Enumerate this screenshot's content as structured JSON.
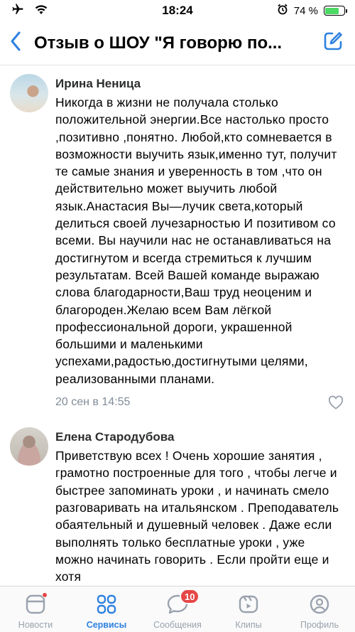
{
  "status_bar": {
    "time": "18:24",
    "battery_percent": "74 %",
    "battery_level": 0.74,
    "icons": [
      "airplane-icon",
      "wifi-icon",
      "alarm-icon",
      "battery-icon"
    ]
  },
  "header": {
    "title": "Отзыв о ШОУ \"Я говорю по...",
    "icons": [
      "back-chevron-icon",
      "edit-icon"
    ]
  },
  "comments": [
    {
      "author": "Ирина Неница",
      "text": "Никогда в жизни не получала столько положительной энергии.Все настолько просто ,позитивно ,понятно. Любой,кто сомневается в возможности выучить язык,именно тут, получит те самые знания и уверенность в том ,что он действительно может выучить любой язык.Анастасия Вы—лучик света,который делиться своей лучезарностью И позитивом со всеми. Вы научили нас не останавливаться на достигнутом и всегда стремиться к лучшим результатам. Всей  Вашей команде выражаю слова благодарности,Ваш труд неоценим и благороден.Желаю всем Вам лёгкой профессиональной дороги, украшенной большими и маленькими успехами,радостью,достигнутыми целями, реализованными планами.",
      "date": "20 сен в 14:55"
    },
    {
      "author": "Елена Стародубова",
      "text": "Приветствую всех ! Очень хорошие занятия , грамотно построенные для того , чтобы легче и быстрее запоминать уроки , и начинать смело разговаривать на итальянском . Преподаватель обаятельный и душевный человек . Даже если выполнять только бесплатные уроки , уже можно начинать говорить . Если пройти еще и хотя"
    }
  ],
  "tabbar": {
    "tabs": [
      {
        "label": "Новости",
        "icon": "news-icon"
      },
      {
        "label": "Сервисы",
        "icon": "services-icon"
      },
      {
        "label": "Сообщения",
        "icon": "messages-icon",
        "badge": "10"
      },
      {
        "label": "Клипы",
        "icon": "clips-icon"
      },
      {
        "label": "Профиль",
        "icon": "profile-icon"
      }
    ],
    "active_tab": "Сервисы"
  },
  "colors": {
    "accent": "#2d81e0",
    "badge": "#e64646",
    "secondary_text": "#818c99",
    "inactive_tab": "#99a2ad"
  }
}
